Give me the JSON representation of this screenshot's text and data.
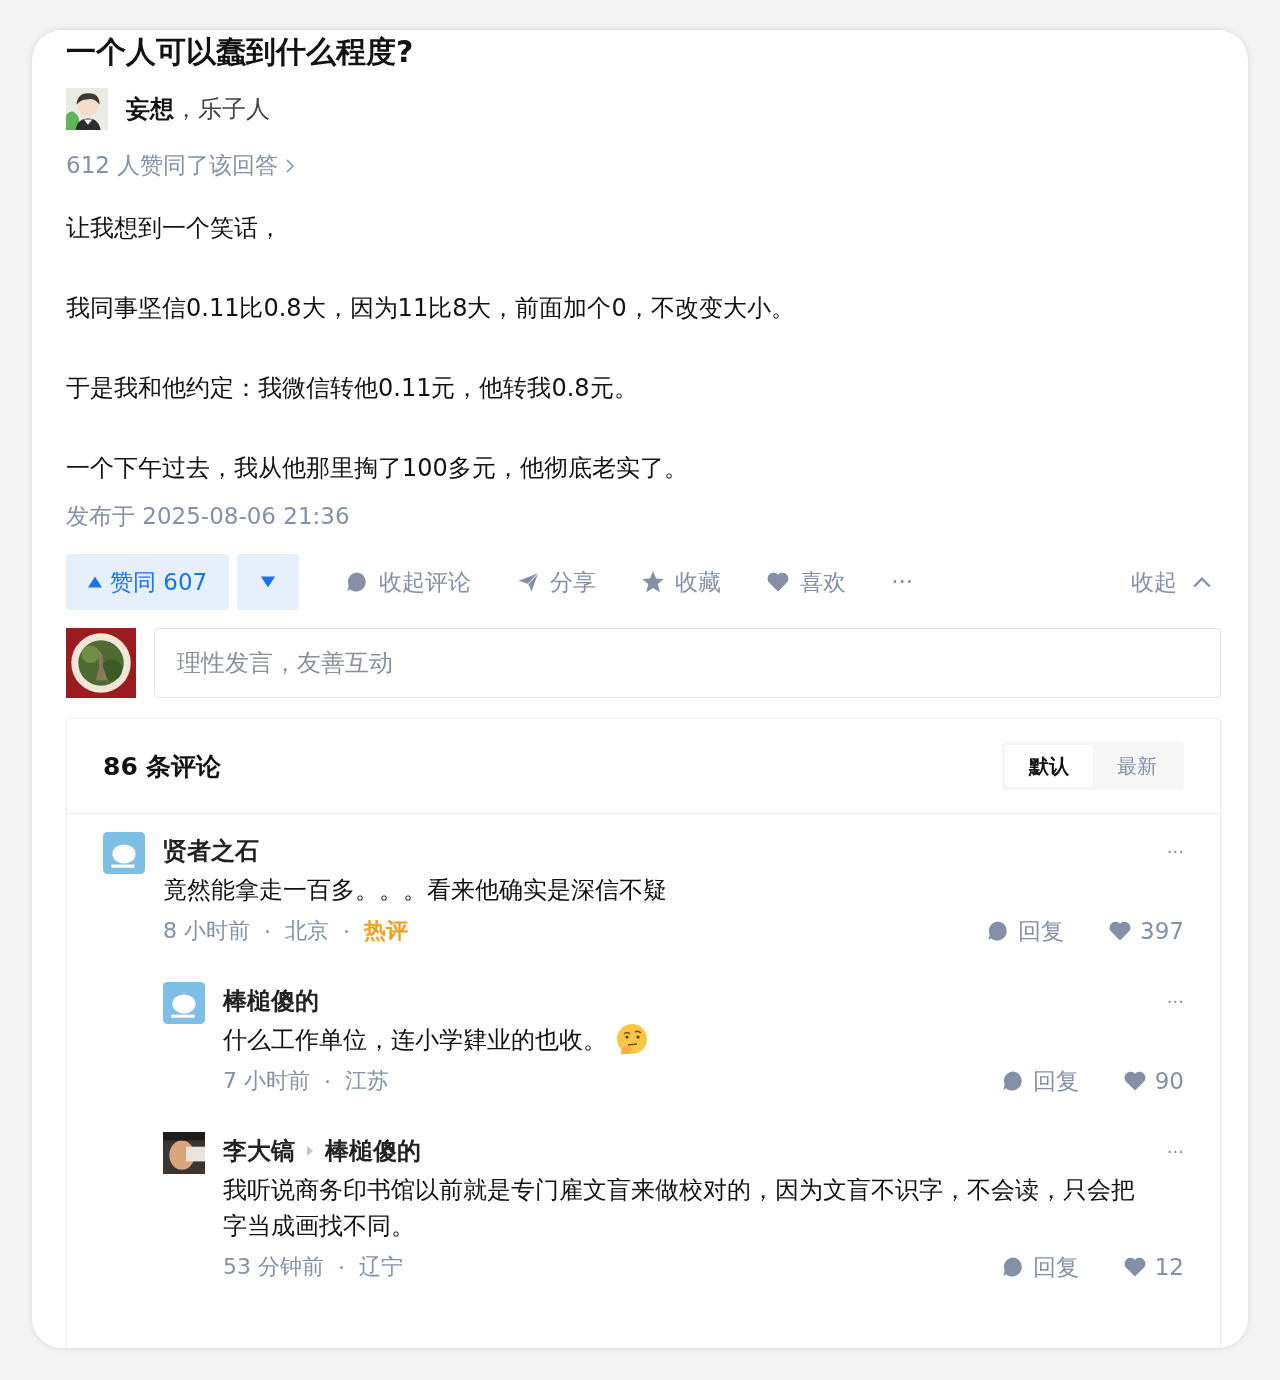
{
  "question": {
    "title": "一个人可以蠢到什么程度?"
  },
  "author": {
    "name": "妄想",
    "separator": "，",
    "bio": "乐子人"
  },
  "upvote_summary": "612 人赞同了该回答",
  "paragraphs": [
    "让我想到一个笑话，",
    "我同事坚信0.11比0.8大，因为11比8大，前面加个0，不改变大小。",
    "于是我和他约定：我微信转他0.11元，他转我0.8元。",
    "一个下午过去，我从他那里掏了100多元，他彻底老实了。"
  ],
  "published": "发布于 2025-08-06 21:36",
  "actions": {
    "upvote": "赞同 607",
    "items": [
      {
        "kind": "comment",
        "label": "收起评论"
      },
      {
        "kind": "share",
        "label": "分享"
      },
      {
        "kind": "star",
        "label": "收藏"
      },
      {
        "kind": "heart",
        "label": "喜欢"
      },
      {
        "kind": "more",
        "label": "···"
      }
    ],
    "collapse": "收起"
  },
  "comment_input": {
    "placeholder": "理性发言，友善互动"
  },
  "comments": {
    "count": "86 条评论",
    "sort_tabs": [
      {
        "label": "默认",
        "selected": true
      },
      {
        "label": "最新",
        "selected": false
      }
    ],
    "items": [
      {
        "author": "贤者之石",
        "text": "竟然能拿走一百多。。。看来他确实是深信不疑",
        "time": "8 小时前",
        "separator": "·",
        "location": "北京",
        "tag": "热评",
        "reply": "回复",
        "likes": "397",
        "more": "···",
        "children": [
          {
            "author": "棒槌傻的",
            "text": "什么工作单位，连小学肄业的也收。",
            "emoji": true,
            "time": "7 小时前",
            "separator": "·",
            "location": "江苏",
            "reply": "回复",
            "likes": "90",
            "more": "···"
          },
          {
            "author": "李大镐",
            "reply_to": "棒槌傻的",
            "text": "我听说商务印书馆以前就是专门雇文盲来做校对的，因为文盲不识字，不会读，只会把字当成画找不同。",
            "time": "53 分钟前",
            "separator": "·",
            "location": "辽宁",
            "reply": "回复",
            "likes": "12",
            "more": "···",
            "photo_avatar": true
          }
        ]
      }
    ]
  }
}
